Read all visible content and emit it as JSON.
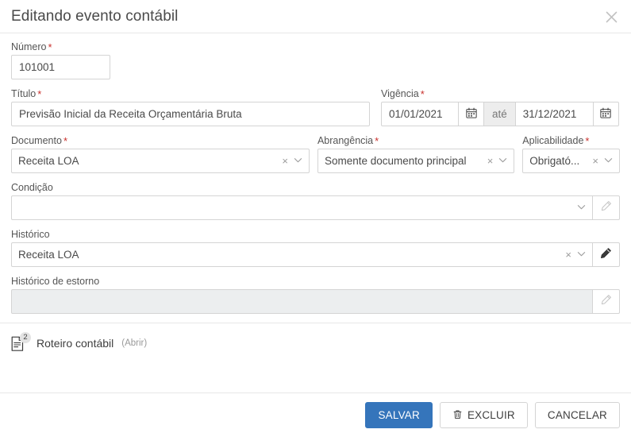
{
  "dialog": {
    "title": "Editando evento contábil",
    "close_icon": "close-icon"
  },
  "fields": {
    "numero": {
      "label": "Número",
      "required": "*",
      "value": "101001"
    },
    "titulo": {
      "label": "Título",
      "required": "*",
      "value": "Previsão Inicial da Receita Orçamentária Bruta"
    },
    "vigencia": {
      "label": "Vigência",
      "required": "*",
      "start": "01/01/2021",
      "separator": "até",
      "end": "31/12/2021",
      "calendar_icon": "calendar-icon"
    },
    "documento": {
      "label": "Documento",
      "required": "*",
      "value": "Receita LOA",
      "clear": "×"
    },
    "abrangencia": {
      "label": "Abrangência",
      "required": "*",
      "value": "Somente documento principal",
      "clear": "×"
    },
    "aplicabilidade": {
      "label": "Aplicabilidade",
      "required": "*",
      "value": "Obrigató...",
      "clear": "×"
    },
    "condicao": {
      "label": "Condição",
      "value": "",
      "edit_icon": "pencil-icon"
    },
    "historico": {
      "label": "Histórico",
      "value": "Receita LOA",
      "clear": "×",
      "edit_icon": "pencil-icon"
    },
    "historico_estorno": {
      "label": "Histórico de estorno",
      "value": "",
      "edit_icon": "pencil-icon"
    }
  },
  "attachment": {
    "icon": "document-icon",
    "badge": "2",
    "label": "Roteiro contábil",
    "link": "(Abrir)"
  },
  "footer": {
    "save_label": "SALVAR",
    "delete_label": "EXCLUIR",
    "delete_icon": "trash-icon",
    "cancel_label": "CANCELAR"
  },
  "colors": {
    "primary": "#3575bb",
    "required": "#c9302c",
    "border": "#d4d4d4",
    "disabled_bg": "#eceeef"
  }
}
